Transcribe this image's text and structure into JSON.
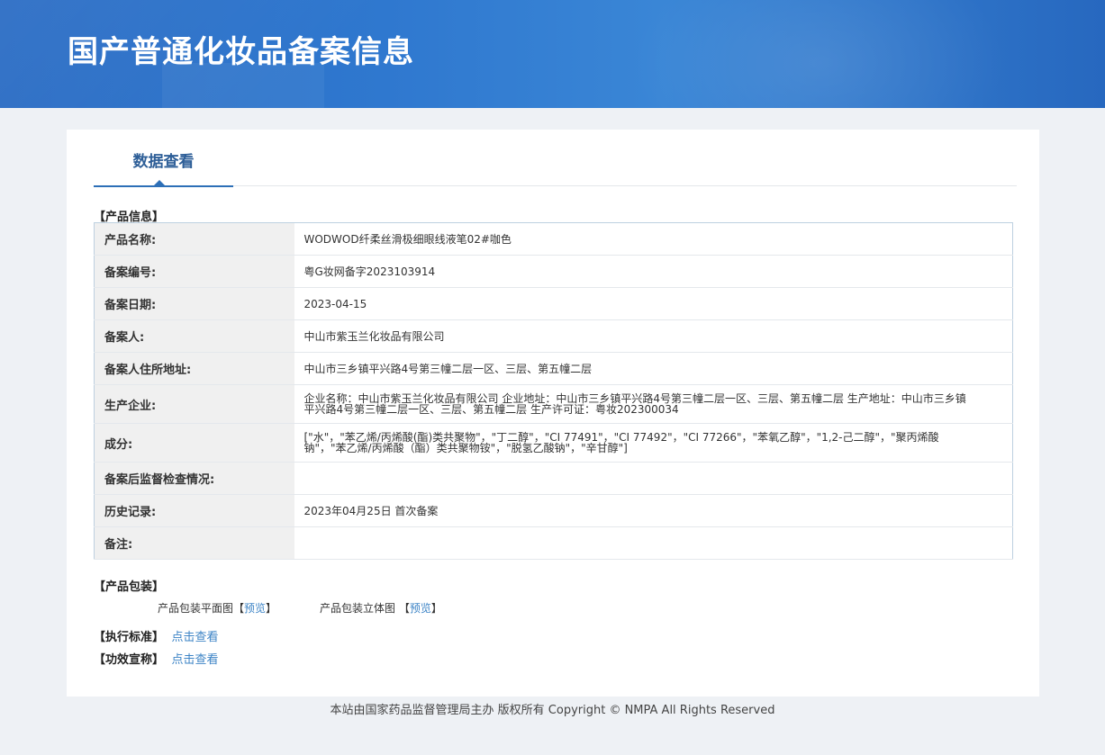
{
  "header": {
    "title": "国产普通化妆品备案信息"
  },
  "tabs": {
    "active": "数据查看"
  },
  "product_info": {
    "section_title": "【产品信息】",
    "rows": [
      {
        "label": "产品名称:",
        "value": "WODWOD纤柔丝滑极细眼线液笔02#咖色"
      },
      {
        "label": "备案编号:",
        "value": "粤G妆网备字2023103914"
      },
      {
        "label": "备案日期:",
        "value": "2023-04-15"
      },
      {
        "label": "备案人:",
        "value": "中山市紫玉兰化妆品有限公司"
      },
      {
        "label": "备案人住所地址:",
        "value": "中山市三乡镇平兴路4号第三幢二层一区、三层、第五幢二层"
      },
      {
        "label": "生产企业:",
        "value": "企业名称：中山市紫玉兰化妆品有限公司 企业地址：中山市三乡镇平兴路4号第三幢二层一区、三层、第五幢二层 生产地址：中山市三乡镇平兴路4号第三幢二层一区、三层、第五幢二层 生产许可证：粤妆202300034"
      },
      {
        "label": "成分:",
        "value": "[\"水\"，\"苯乙烯/丙烯酸(酯)类共聚物\"，\"丁二醇\"，\"CI 77491\"，\"CI 77492\"，\"CI 77266\"，\"苯氧乙醇\"，\"1,2-己二醇\"，\"聚丙烯酸钠\"，\"苯乙烯/丙烯酸（酯）类共聚物铵\"，\"脱氢乙酸钠\"，\"辛甘醇\"]"
      },
      {
        "label": "备案后监督检查情况:",
        "value": ""
      },
      {
        "label": "历史记录:",
        "value": "2023年04月25日 首次备案"
      },
      {
        "label": "备注:",
        "value": ""
      }
    ]
  },
  "packaging": {
    "section_title": "【产品包装】",
    "flat_label": "产品包装平面图",
    "stereo_label": "产品包装立体图",
    "bracket_open": "【",
    "bracket_close": "】",
    "preview_link": "预览"
  },
  "standard": {
    "label": "【执行标准】",
    "link": "点击查看"
  },
  "efficacy": {
    "label": "【功效宣称】",
    "link": "点击查看"
  },
  "footer": {
    "text": "本站由国家药品监督管理局主办 版权所有 Copyright © NMPA All Rights Reserved"
  }
}
